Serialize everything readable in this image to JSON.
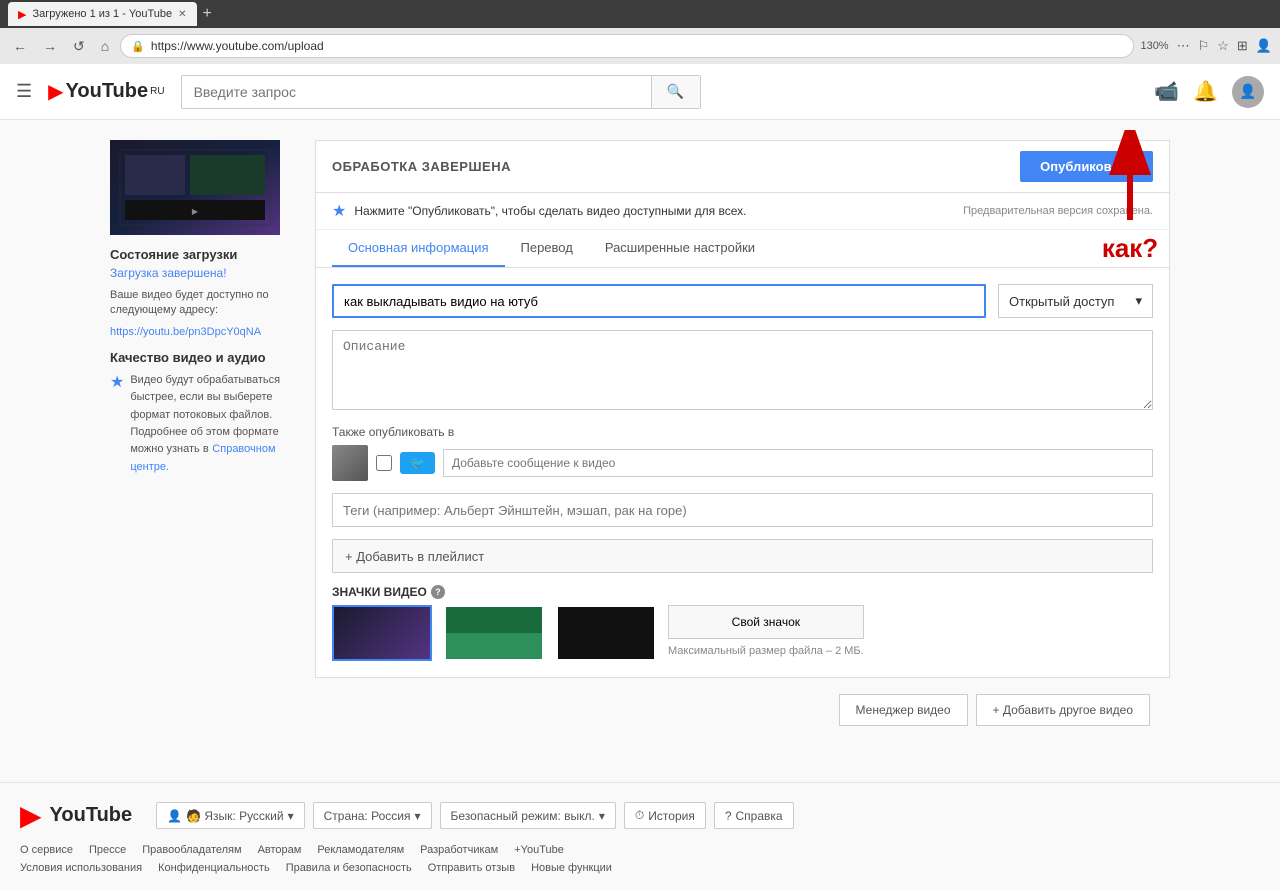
{
  "browser": {
    "tab_title": "Загружено 1 из 1 - YouTube",
    "url": "https://www.youtube.com/upload",
    "zoom": "130%"
  },
  "header": {
    "search_placeholder": "Введите запрос",
    "logo_text": "YouTube",
    "logo_suffix": "RU"
  },
  "upload": {
    "processing_status": "ОБРАБОТКА ЗАВЕРШЕНА",
    "publish_btn": "Опубликовать",
    "star_notice": "Нажмите \"Опубликовать\", чтобы сделать видео доступными для всех.",
    "draft_saved": "Предварительная версия сохранена.",
    "tabs": [
      "Основная информация",
      "Перевод",
      "Расширенные настройки"
    ],
    "active_tab": 0,
    "title_value": "как выкладывать видио на ютуб",
    "description_placeholder": "Описание",
    "privacy_label": "Открытый доступ",
    "also_publish_label": "Также опубликовать в",
    "twitter_msg_placeholder": "Добавьте сообщение к видео",
    "tags_placeholder": "Теги (например: Альберт Эйнштейн, мэшап, рак на горе)",
    "playlist_btn": "+ Добавить в плейлист",
    "thumbnails_label": "ЗНАЧКИ ВИДЕО",
    "custom_thumb_btn": "Свой значок",
    "thumb_size_note": "Максимальный размер файла – 2 МБ."
  },
  "status": {
    "title": "Состояние загрузки",
    "done": "Загрузка завершена!",
    "info": "Ваше видео будет доступно по следующему адресу:",
    "link": "https://youtu.be/pn3DpcY0qNA",
    "quality_title": "Качество видео и аудио",
    "quality_info": "Видео будут обрабатываться быстрее, если вы выберете формат потоковых файлов. Подробнее об этом формате можно узнать в",
    "quality_link": "Справочном центре."
  },
  "bottom": {
    "manager_btn": "Менеджер видео",
    "add_btn": "+ Добавить другое видео"
  },
  "annotation": {
    "text": "как?"
  },
  "footer": {
    "logo": "YouTube",
    "language_btn": "🧑 Язык: Русский",
    "country_btn": "Страна: Россия",
    "safety_btn": "Безопасный режим: выкл.",
    "history_btn": "⏱ История",
    "help_btn": "? Справка",
    "links1": [
      "О сервисе",
      "Прессе",
      "Правообладателям",
      "Авторам",
      "Рекламодателям",
      "Разработчикам",
      "+YouTube"
    ],
    "links2": [
      "Условия использования",
      "Конфиденциальность",
      "Правила и безопасность",
      "Отправить отзыв",
      "Новые функции"
    ]
  }
}
